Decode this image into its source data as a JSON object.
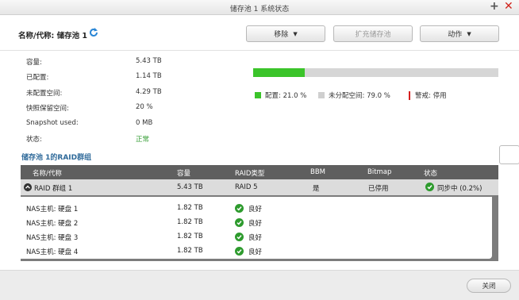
{
  "window": {
    "title": "储存池 1 系统状态",
    "plus_glyph": "+",
    "close_glyph": "✕"
  },
  "header": {
    "name_label": "名称/代称: 储存池 1",
    "buttons": {
      "remove": "移除",
      "expand": "扩充储存池",
      "action": "动作"
    },
    "caret": "▼"
  },
  "info": {
    "rows": [
      {
        "label": "容量:",
        "value": "5.43 TB"
      },
      {
        "label": "已配置:",
        "value": "1.14 TB"
      },
      {
        "label": "未配置空间:",
        "value": "4.29 TB"
      },
      {
        "label": "快照保留空间:",
        "value": "20 %"
      },
      {
        "label": "Snapshot used:",
        "value": "0 MB"
      },
      {
        "label": "状态:",
        "value": "正常"
      }
    ]
  },
  "usage": {
    "allocated_fraction": 0.21,
    "legend": {
      "allocated": "配置: 21.0 %",
      "unallocated": "未分配空间:  79.0 %",
      "warning": "警戒: 停用"
    },
    "colors": {
      "allocated": "#3bc42a",
      "unallocated": "#d6d6d6",
      "warning": "#d61f1f"
    }
  },
  "raid": {
    "section_title": "储存池 1的RAID群组",
    "headers": {
      "name": "名称/代称",
      "capacity": "容量",
      "raid_type": "RAID类型",
      "bbm": "BBM",
      "bitmap": "Bitmap",
      "status": "状态"
    },
    "group": {
      "name": "RAID 群组 1",
      "capacity": "5.43 TB",
      "raid_type": "RAID 5",
      "bbm": "是",
      "bitmap": "已停用",
      "status": "同步中 (0.2%)"
    },
    "disks": [
      {
        "name": "NAS主机: 硬盘 1",
        "capacity": "1.82 TB",
        "status": "良好"
      },
      {
        "name": "NAS主机: 硬盘 2",
        "capacity": "1.82 TB",
        "status": "良好"
      },
      {
        "name": "NAS主机: 硬盘 3",
        "capacity": "1.82 TB",
        "status": "良好"
      },
      {
        "name": "NAS主机: 硬盘 4",
        "capacity": "1.82 TB",
        "status": "良好"
      }
    ]
  },
  "footer": {
    "close": "关闭"
  }
}
